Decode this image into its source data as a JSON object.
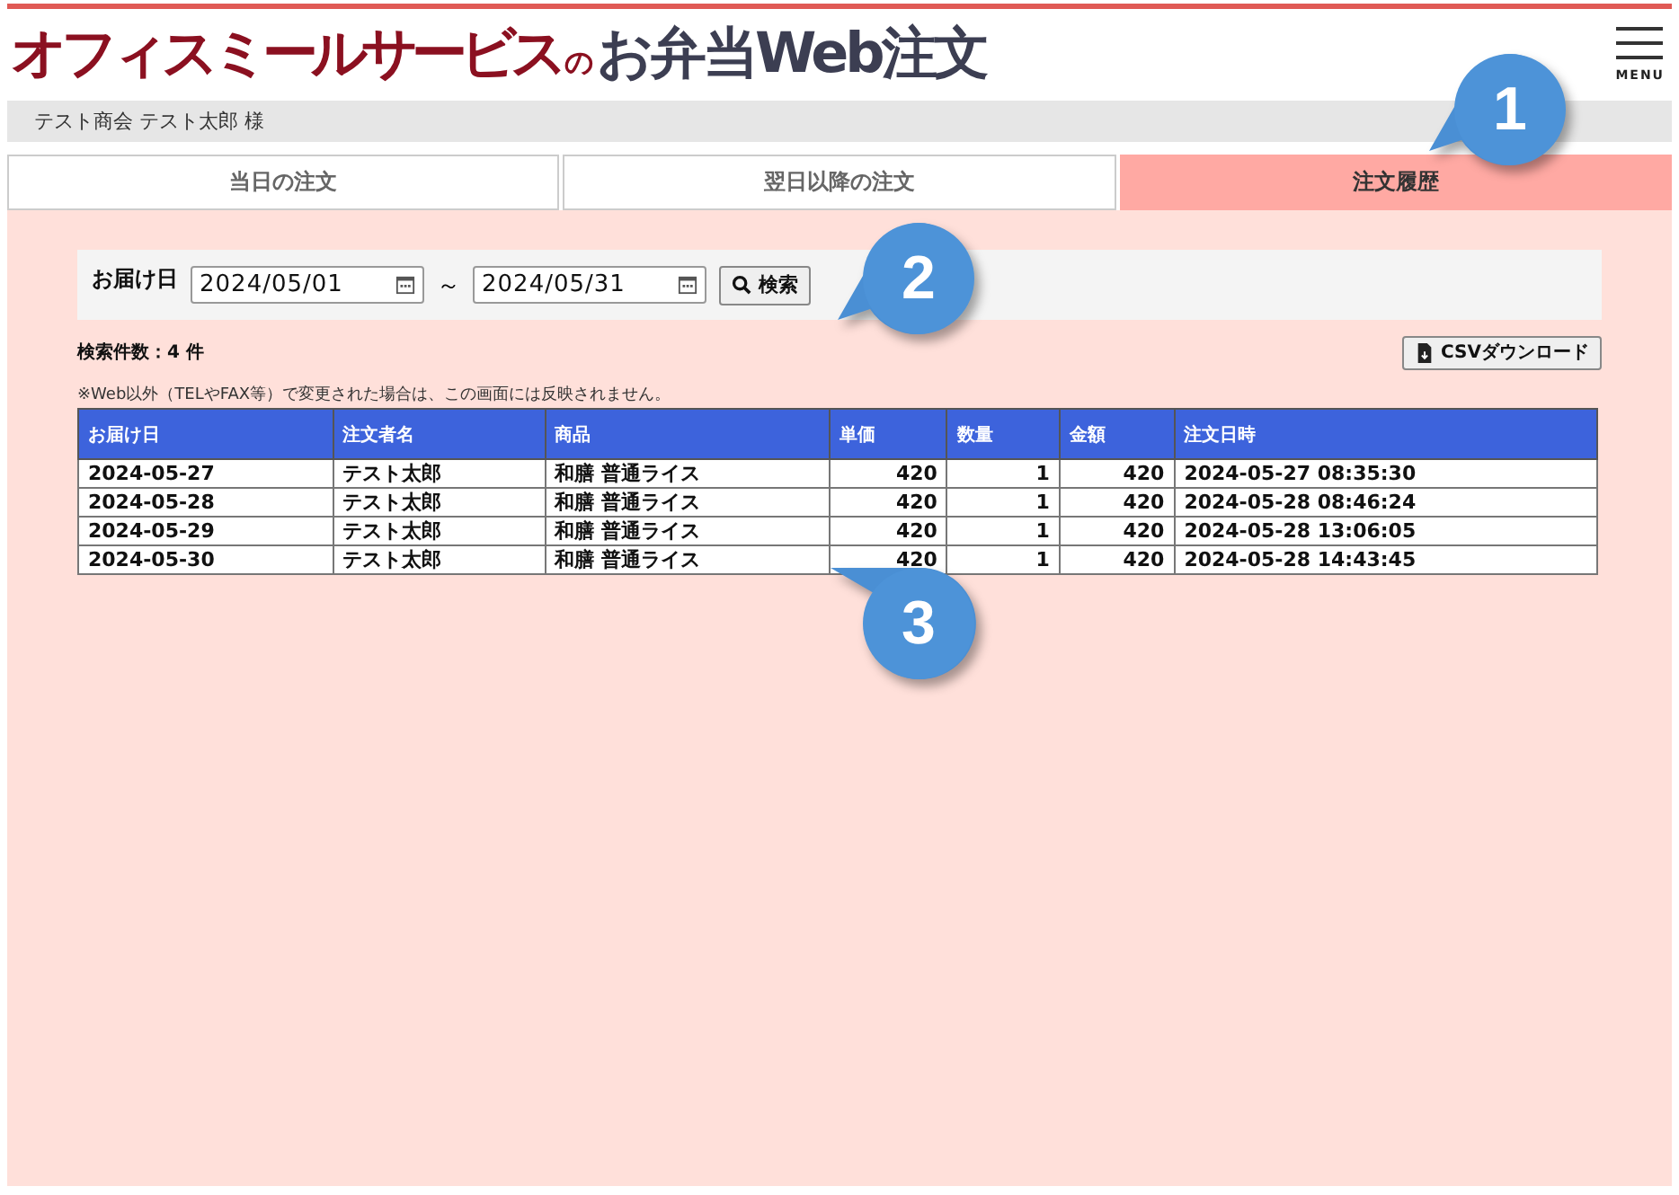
{
  "header": {
    "brand": "オフィスミールサービス",
    "particle": "の",
    "service": "お弁当Web注文",
    "menu_label": "MENU"
  },
  "user_bar": "テスト商会 テスト太郎 様",
  "tabs": [
    {
      "label": "当日の注文",
      "selected": false
    },
    {
      "label": "翌日以降の注文",
      "selected": false
    },
    {
      "label": "注文履歴",
      "selected": true
    }
  ],
  "search": {
    "label": "お届け日",
    "from": "2024/05/01",
    "separator": "～",
    "to": "2024/05/31",
    "button": "検索"
  },
  "result_count": "検索件数：4 件",
  "csv_button": "CSVダウンロード",
  "note": "※Web以外（TELやFAX等）で変更された場合は、この画面には反映されません。",
  "table": {
    "columns": [
      {
        "label": "お届け日",
        "kind": "text"
      },
      {
        "label": "注文者名",
        "kind": "text"
      },
      {
        "label": "商品",
        "kind": "text"
      },
      {
        "label": "単価",
        "kind": "number"
      },
      {
        "label": "数量",
        "kind": "number"
      },
      {
        "label": "金額",
        "kind": "number"
      },
      {
        "label": "注文日時",
        "kind": "text"
      }
    ],
    "rows": [
      [
        "2024-05-27",
        "テスト太郎",
        "和膳 普通ライス",
        "420",
        "1",
        "420",
        "2024-05-27 08:35:30"
      ],
      [
        "2024-05-28",
        "テスト太郎",
        "和膳 普通ライス",
        "420",
        "1",
        "420",
        "2024-05-28 08:46:24"
      ],
      [
        "2024-05-29",
        "テスト太郎",
        "和膳 普通ライス",
        "420",
        "1",
        "420",
        "2024-05-28 13:06:05"
      ],
      [
        "2024-05-30",
        "テスト太郎",
        "和膳 普通ライス",
        "420",
        "1",
        "420",
        "2024-05-28 14:43:45"
      ]
    ]
  },
  "callouts": [
    "1",
    "2",
    "3"
  ]
}
